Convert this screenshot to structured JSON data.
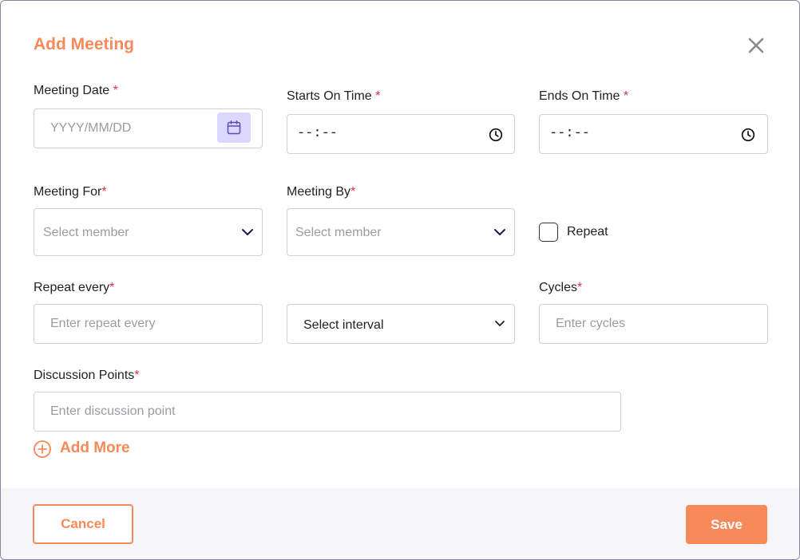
{
  "modal": {
    "title": "Add Meeting",
    "accent_color": "#f68a5a",
    "required_marker": "*"
  },
  "fields": {
    "meeting_date": {
      "label": "Meeting Date ",
      "placeholder": "YYYY/MM/DD"
    },
    "starts_on_time": {
      "label": "Starts On Time ",
      "value": "--:--"
    },
    "ends_on_time": {
      "label": "Ends On Time ",
      "value": "--:--"
    },
    "meeting_for": {
      "label": "Meeting For",
      "placeholder": "Select member"
    },
    "meeting_by": {
      "label": "Meeting By",
      "placeholder": "Select member"
    },
    "repeat": {
      "label": "Repeat",
      "checked": false
    },
    "repeat_every": {
      "label": "Repeat every",
      "placeholder": "Enter repeat every"
    },
    "interval": {
      "value": "Select interval"
    },
    "cycles": {
      "label": "Cycles",
      "placeholder": "Enter cycles"
    },
    "discussion_points": {
      "label": "Discussion Points",
      "placeholder": "Enter discussion point"
    }
  },
  "add_more": {
    "label": "Add More"
  },
  "footer": {
    "cancel_label": "Cancel",
    "save_label": "Save"
  }
}
